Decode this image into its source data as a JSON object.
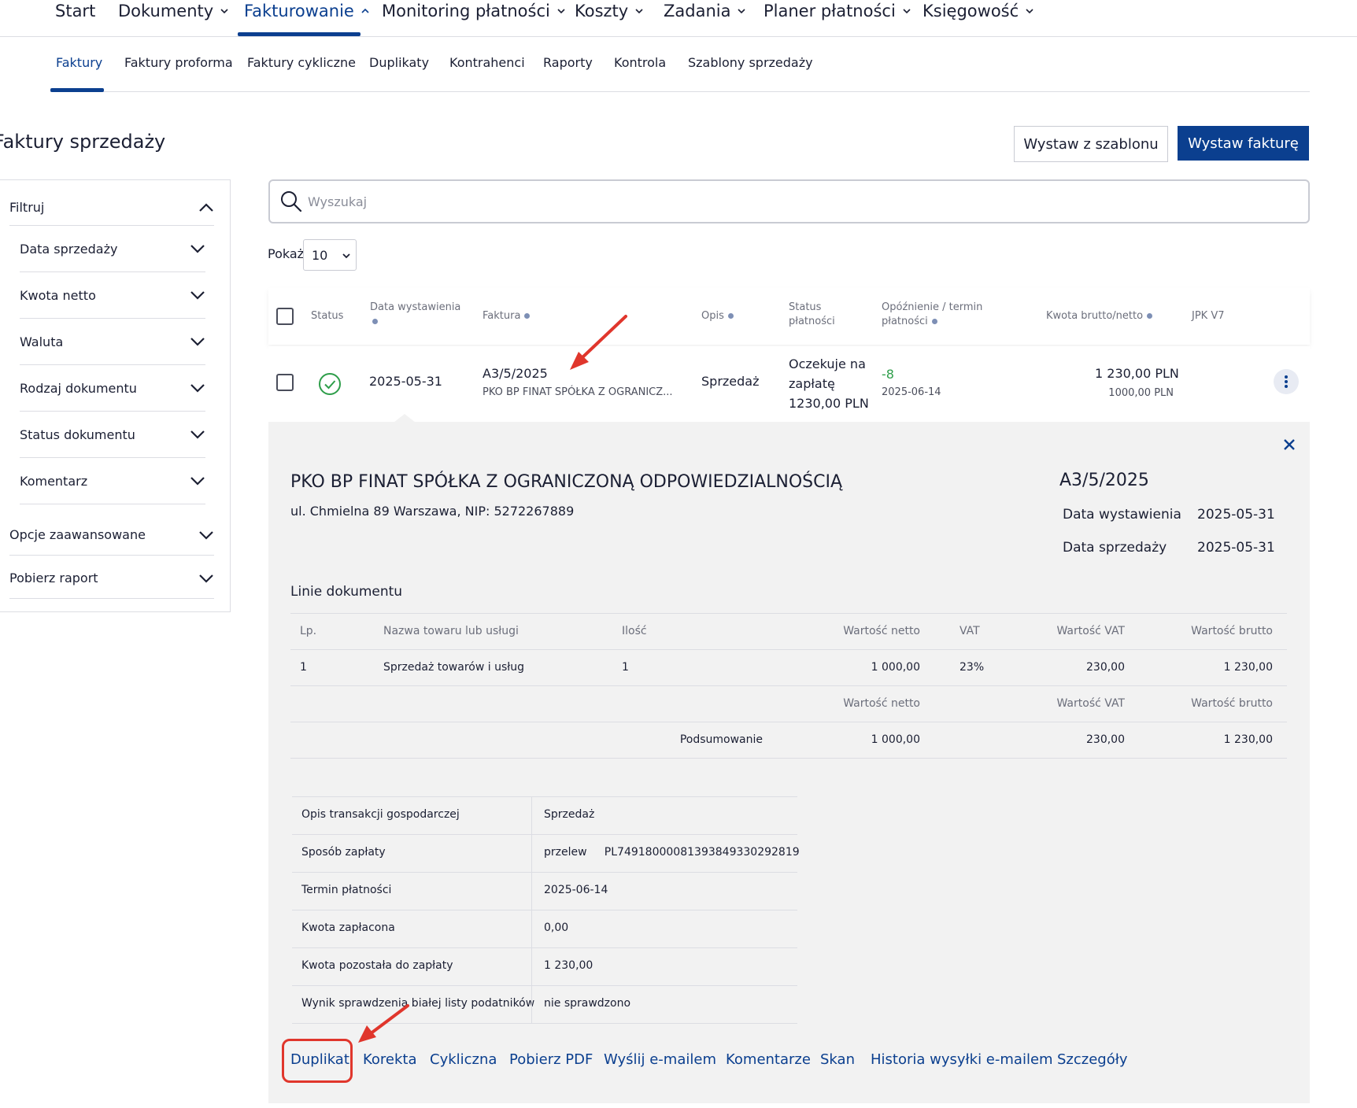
{
  "top_nav": {
    "items": [
      {
        "label": "Start",
        "has_menu": false
      },
      {
        "label": "Dokumenty",
        "has_menu": true
      },
      {
        "label": "Fakturowanie",
        "has_menu": true,
        "active": true
      },
      {
        "label": "Monitoring płatności",
        "has_menu": true
      },
      {
        "label": "Koszty",
        "has_menu": true
      },
      {
        "label": "Zadania",
        "has_menu": true
      },
      {
        "label": "Planer płatności",
        "has_menu": true
      },
      {
        "label": "Księgowość",
        "has_menu": true
      }
    ]
  },
  "sub_nav": {
    "items": [
      "Faktury",
      "Faktury proforma",
      "Faktury cykliczne",
      "Duplikaty",
      "Kontrahenci",
      "Raporty",
      "Kontrola",
      "Szablony sprzedaży"
    ],
    "active": "Faktury"
  },
  "page_title": "Faktury sprzedaży",
  "buttons": {
    "from_template": "Wystaw z szablonu",
    "issue_invoice": "Wystaw fakturę"
  },
  "filters": {
    "title": "Filtruj",
    "items": [
      "Data sprzedaży",
      "Kwota netto",
      "Waluta",
      "Rodzaj dokumentu",
      "Status dokumentu",
      "Komentarz"
    ],
    "advanced": "Opcje zaawansowane",
    "report": "Pobierz raport"
  },
  "search": {
    "placeholder": "Wyszukaj",
    "value": ""
  },
  "page_size": {
    "label": "Pokaż",
    "value": "10"
  },
  "table": {
    "headers": {
      "status": "Status",
      "issue_date": "Data wystawienia",
      "invoice": "Faktura",
      "description": "Opis",
      "payment_status_1": "Status",
      "payment_status_2": "płatności",
      "delay_1": "Opóźnienie / termin",
      "delay_2": "płatności",
      "amount": "Kwota brutto/netto",
      "jpk": "JPK V7"
    },
    "row": {
      "issue_date": "2025-05-31",
      "invoice_number": "A3/5/2025",
      "contractor_short": "PKO BP FINAT SPÓŁKA Z OGRANICZ...",
      "description": "Sprzedaż",
      "payment_status_1": "Oczekuje na",
      "payment_status_2": "zapłatę",
      "payment_status_3": "1230,00 PLN",
      "delay_days": "-8",
      "due_date": "2025-06-14",
      "gross": "1 230,00 PLN",
      "net": "1000,00 PLN"
    }
  },
  "details": {
    "contractor": "PKO BP FINAT SPÓŁKA Z OGRANICZONĄ ODPOWIEDZIALNOŚCIĄ",
    "address": "ul. Chmielna 89 Warszawa, NIP: 5272267889",
    "invoice_number": "A3/5/2025",
    "issue_date_label": "Data wystawienia",
    "issue_date": "2025-05-31",
    "sale_date_label": "Data sprzedaży",
    "sale_date": "2025-05-31",
    "lines_title": "Linie dokumentu",
    "lines_headers": {
      "lp": "Lp.",
      "name": "Nazwa towaru lub usługi",
      "qty": "Ilość",
      "net": "Wartość netto",
      "vat": "VAT",
      "vat_value": "Wartość VAT",
      "gross": "Wartość brutto"
    },
    "line": {
      "lp": "1",
      "name": "Sprzedaż towarów i usług",
      "qty": "1",
      "net": "1 000,00",
      "vat": "23%",
      "vat_value": "230,00",
      "gross": "1 230,00"
    },
    "summary_headers": {
      "net": "Wartość netto",
      "vat_value": "Wartość VAT",
      "gross": "Wartość brutto"
    },
    "summary": {
      "label": "Podsumowanie",
      "net": "1 000,00",
      "vat_value": "230,00",
      "gross": "1 230,00"
    },
    "info": [
      {
        "label": "Opis transakcji gospodarczej",
        "value": "Sprzedaż"
      },
      {
        "label": "Sposób zapłaty",
        "value": "przelew     PL74918000081393849330292819"
      },
      {
        "label": "Termin płatności",
        "value": "2025-06-14"
      },
      {
        "label": "Kwota zapłacona",
        "value": "0,00"
      },
      {
        "label": "Kwota pozostała do zapłaty",
        "value": "1 230,00"
      },
      {
        "label": "Wynik sprawdzenia białej listy podatników",
        "value": "nie sprawdzono"
      }
    ],
    "actions": [
      "Duplikat",
      "Korekta",
      "Cykliczna",
      "Pobierz PDF",
      "Wyślij e-mailem",
      "Komentarze",
      "Skan",
      "Historia wysyłki e-mailem",
      "Szczegóły"
    ]
  },
  "colors": {
    "accent": "#0b3f8f",
    "success": "#2e9e4a",
    "annotation": "#e0362c",
    "panel_bg": "#f2f2f2"
  }
}
